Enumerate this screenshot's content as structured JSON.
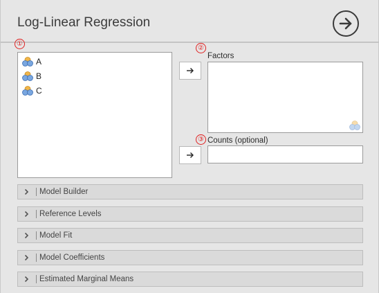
{
  "title": "Log-Linear Regression",
  "markers": [
    "①",
    "②",
    "③"
  ],
  "variables": [
    {
      "name": "A",
      "icon": "nominal-variable-icon"
    },
    {
      "name": "B",
      "icon": "nominal-variable-icon"
    },
    {
      "name": "C",
      "icon": "nominal-variable-icon"
    }
  ],
  "factors": {
    "label": "Factors"
  },
  "counts": {
    "label": "Counts (optional)",
    "value": ""
  },
  "sections": [
    "Model Builder",
    "Reference Levels",
    "Model Fit",
    "Model Coefficients",
    "Estimated Marginal Means"
  ],
  "colors": {
    "background": "#e6e6e6",
    "marker": "#e02020",
    "section_bg": "#dadada"
  }
}
